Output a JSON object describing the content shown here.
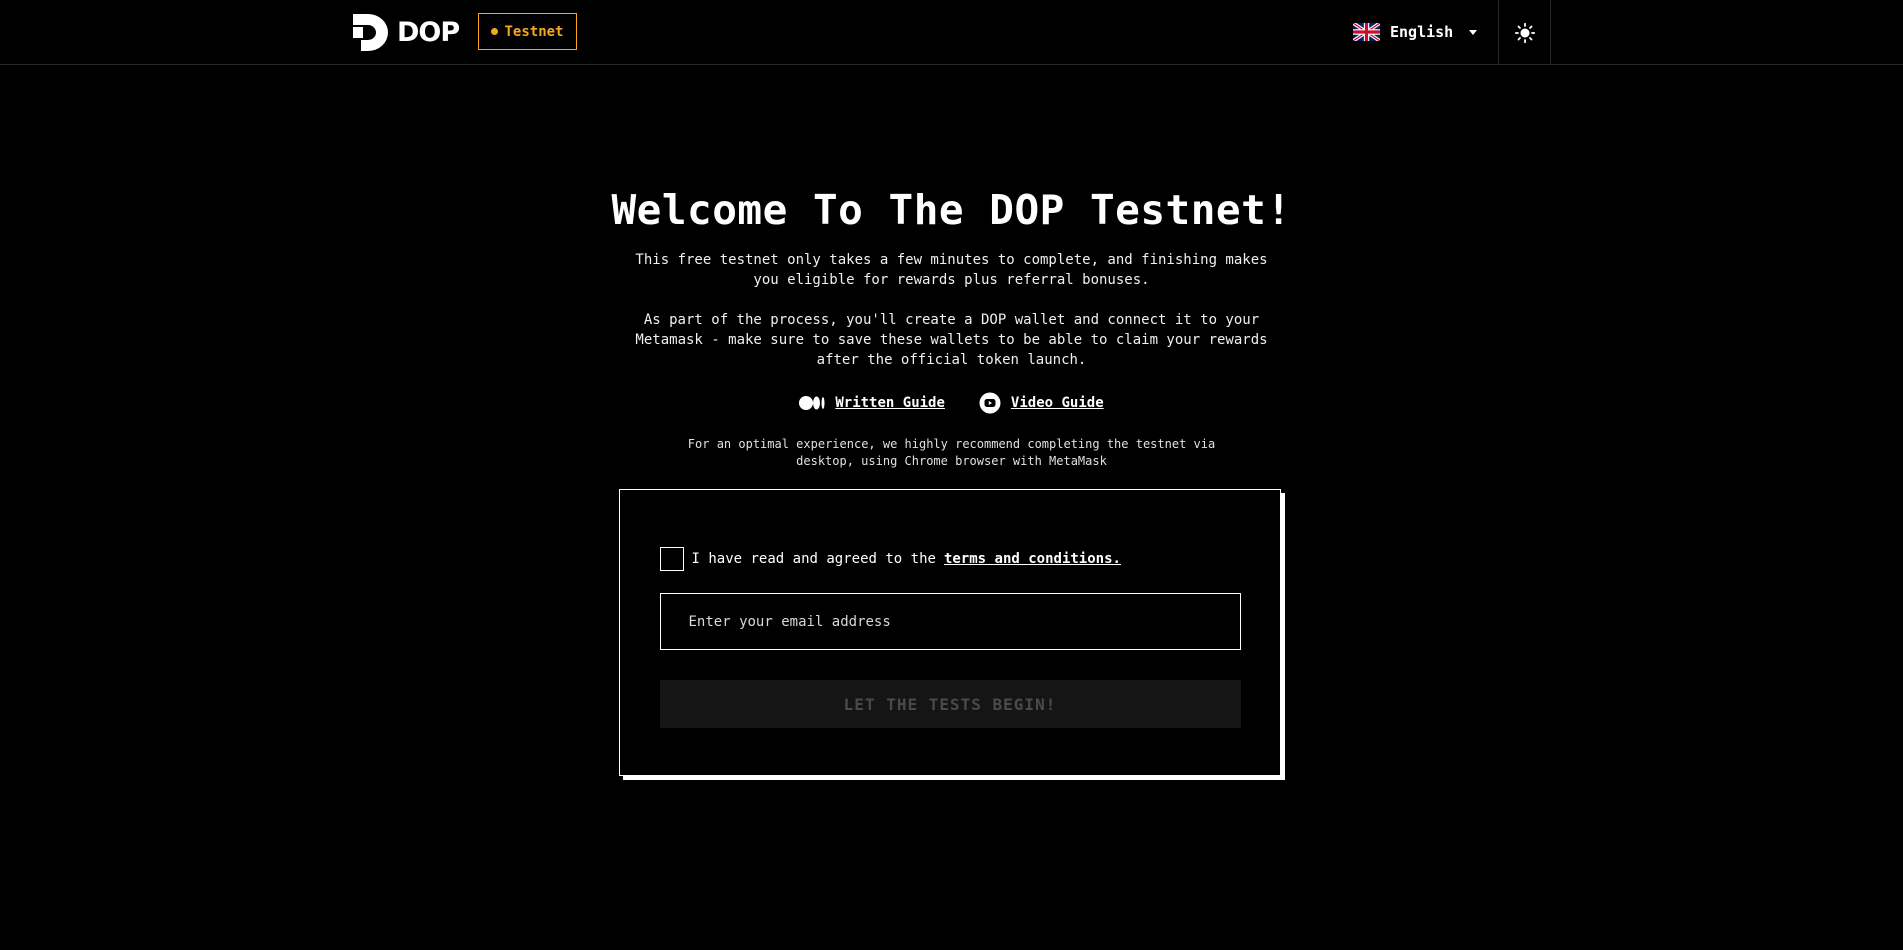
{
  "header": {
    "logo_text": "DOP",
    "badge_label": "Testnet",
    "language_label": "English",
    "accent_color": "#f5a623"
  },
  "hero": {
    "title": "Welcome To The DOP Testnet!",
    "paragraph_1": "This free testnet only takes a few minutes to complete, and finishing makes you eligible for rewards plus referral bonuses.",
    "paragraph_2": "As part of the process, you'll create a DOP wallet and connect it to your Metamask - make sure to save these wallets to be able to claim your rewards after the official token launch."
  },
  "guides": {
    "written_label": "Written Guide",
    "written_icon": "medium-icon",
    "video_label": "Video Guide",
    "video_icon": "youtube-icon"
  },
  "note": "For an optimal experience, we highly recommend completing the testnet via desktop, using Chrome browser with MetaMask",
  "form": {
    "terms_prefix": "I have read and agreed to the",
    "terms_link": "terms and conditions.",
    "email_placeholder": "Enter your email address",
    "submit_label": "LET THE TESTS BEGIN!"
  }
}
